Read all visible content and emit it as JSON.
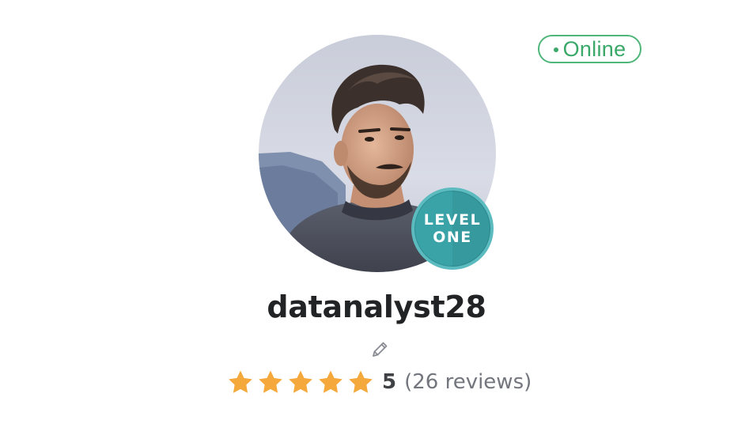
{
  "status": {
    "label": "Online",
    "color": "#3aa868"
  },
  "profile": {
    "username": "datanalyst28",
    "avatar_alt": "profile photo",
    "level_badge": {
      "line1": "LEVEL",
      "line2": "ONE",
      "color": "#39a3a8"
    },
    "edit_icon": "pencil-icon"
  },
  "rating": {
    "score": "5",
    "reviews_text": "(26 reviews)",
    "stars_filled": 5,
    "stars_total": 5,
    "star_color": "#f5a83c"
  }
}
